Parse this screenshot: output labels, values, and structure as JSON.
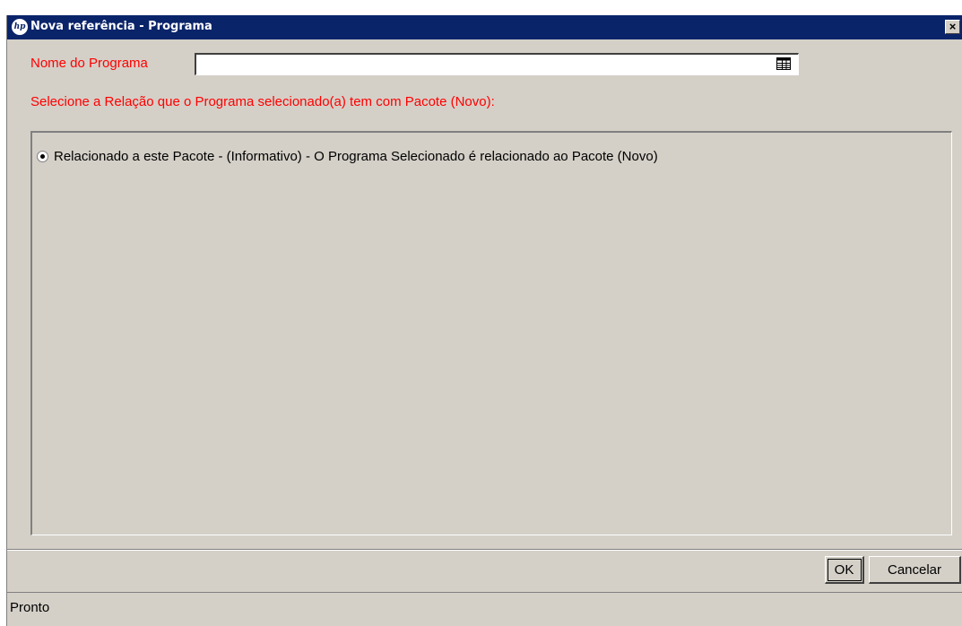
{
  "window": {
    "title": "Nova referência - Programa",
    "close_glyph": "✕",
    "logo_text": "hp",
    "icon": "hp-logo-icon",
    "titlebar_color": "#0a246a"
  },
  "form": {
    "program_label": "Nome do Programa",
    "program_value": "",
    "program_picker_icon": "list-picker-icon",
    "relation_prompt": "Selecione a Relação que o Programa selecionado(a) tem com Pacote (Novo):",
    "label_color": "#ff0000"
  },
  "relations": {
    "selected_index": 0,
    "options": [
      {
        "label": "Relacionado a este Pacote - (Informativo) - O Programa Selecionado é relacionado ao Pacote (Novo)",
        "selected": true
      }
    ]
  },
  "buttons": {
    "ok_label": "OK",
    "cancel_label": "Cancelar"
  },
  "status": {
    "text": "Pronto"
  }
}
